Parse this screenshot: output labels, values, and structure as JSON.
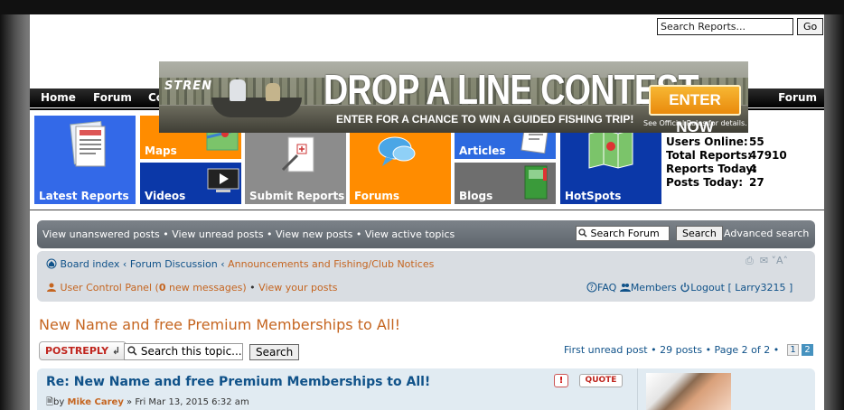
{
  "header": {
    "search_placeholder": "Search Reports...",
    "go_label": "Go"
  },
  "nav": {
    "items": [
      "Home",
      "Forum",
      "Co"
    ],
    "right_item": "Forum"
  },
  "banner": {
    "brand": "STREN",
    "headline": "DROP A LINE CONTEST",
    "subline": "ENTER FOR A CHANCE TO WIN A GUIDED FISHING TRIP!",
    "cta": "ENTER NOW",
    "fineprint": "See Official Rules for details."
  },
  "tiles": {
    "latest_reports": "Latest Reports",
    "maps": "Maps",
    "videos": "Videos",
    "submit_reports": "Submit Reports",
    "forums": "Forums",
    "articles": "Articles",
    "blogs": "Blogs",
    "hotspots": "HotSpots"
  },
  "stats": {
    "users_online_label": "Users Online:",
    "users_online": "55",
    "total_reports_label": "Total Reports:",
    "total_reports": "47910",
    "reports_today_label": "Reports Today:",
    "reports_today": "4",
    "posts_today_label": "Posts Today:",
    "posts_today": "27"
  },
  "forum_bar": {
    "links": "View unanswered posts • View unread posts • View new posts • View active topics",
    "search_placeholder": "Search Forum",
    "search_button": "Search",
    "advanced": "Advanced search"
  },
  "breadcrumb": {
    "board_index": "Board index",
    "sep": "‹",
    "forum_discussion": "Forum Discussion",
    "current": "Announcements and Fishing/Club Notices"
  },
  "user_links": {
    "ucp": "User Control Panel",
    "new_messages_count": "0",
    "new_messages_text": "new messages",
    "your_posts": "View your posts",
    "faq": "FAQ",
    "members": "Members",
    "logout": "Logout [ Larry3215 ]"
  },
  "topic": {
    "title": "New Name and free Premium Memberships to All!",
    "postreply": "POSTREPLY",
    "search_placeholder": "Search this topic...",
    "search_button": "Search",
    "pagination_text": "First unread post • 29 posts • Page 2 of 2 •",
    "page_1": "1",
    "page_2": "2"
  },
  "post": {
    "title": "Re: New Name and free Premium Memberships to All!",
    "by": "by",
    "author": "Mike Carey",
    "date": "» Fri Mar 13, 2015 6:32 am",
    "quote_label": "QUOTE",
    "warn_label": "!"
  },
  "colors": {
    "tile_blue": "#3369e8",
    "tile_orange": "#ff8c00",
    "tile_navy": "#0b38a8",
    "tile_gray": "#8c8c8c",
    "tile_dark_gray": "#6e6e6e",
    "tile_mid_blue": "#2d6ae0",
    "accent_orange": "#c56520",
    "link_blue": "#105289"
  }
}
